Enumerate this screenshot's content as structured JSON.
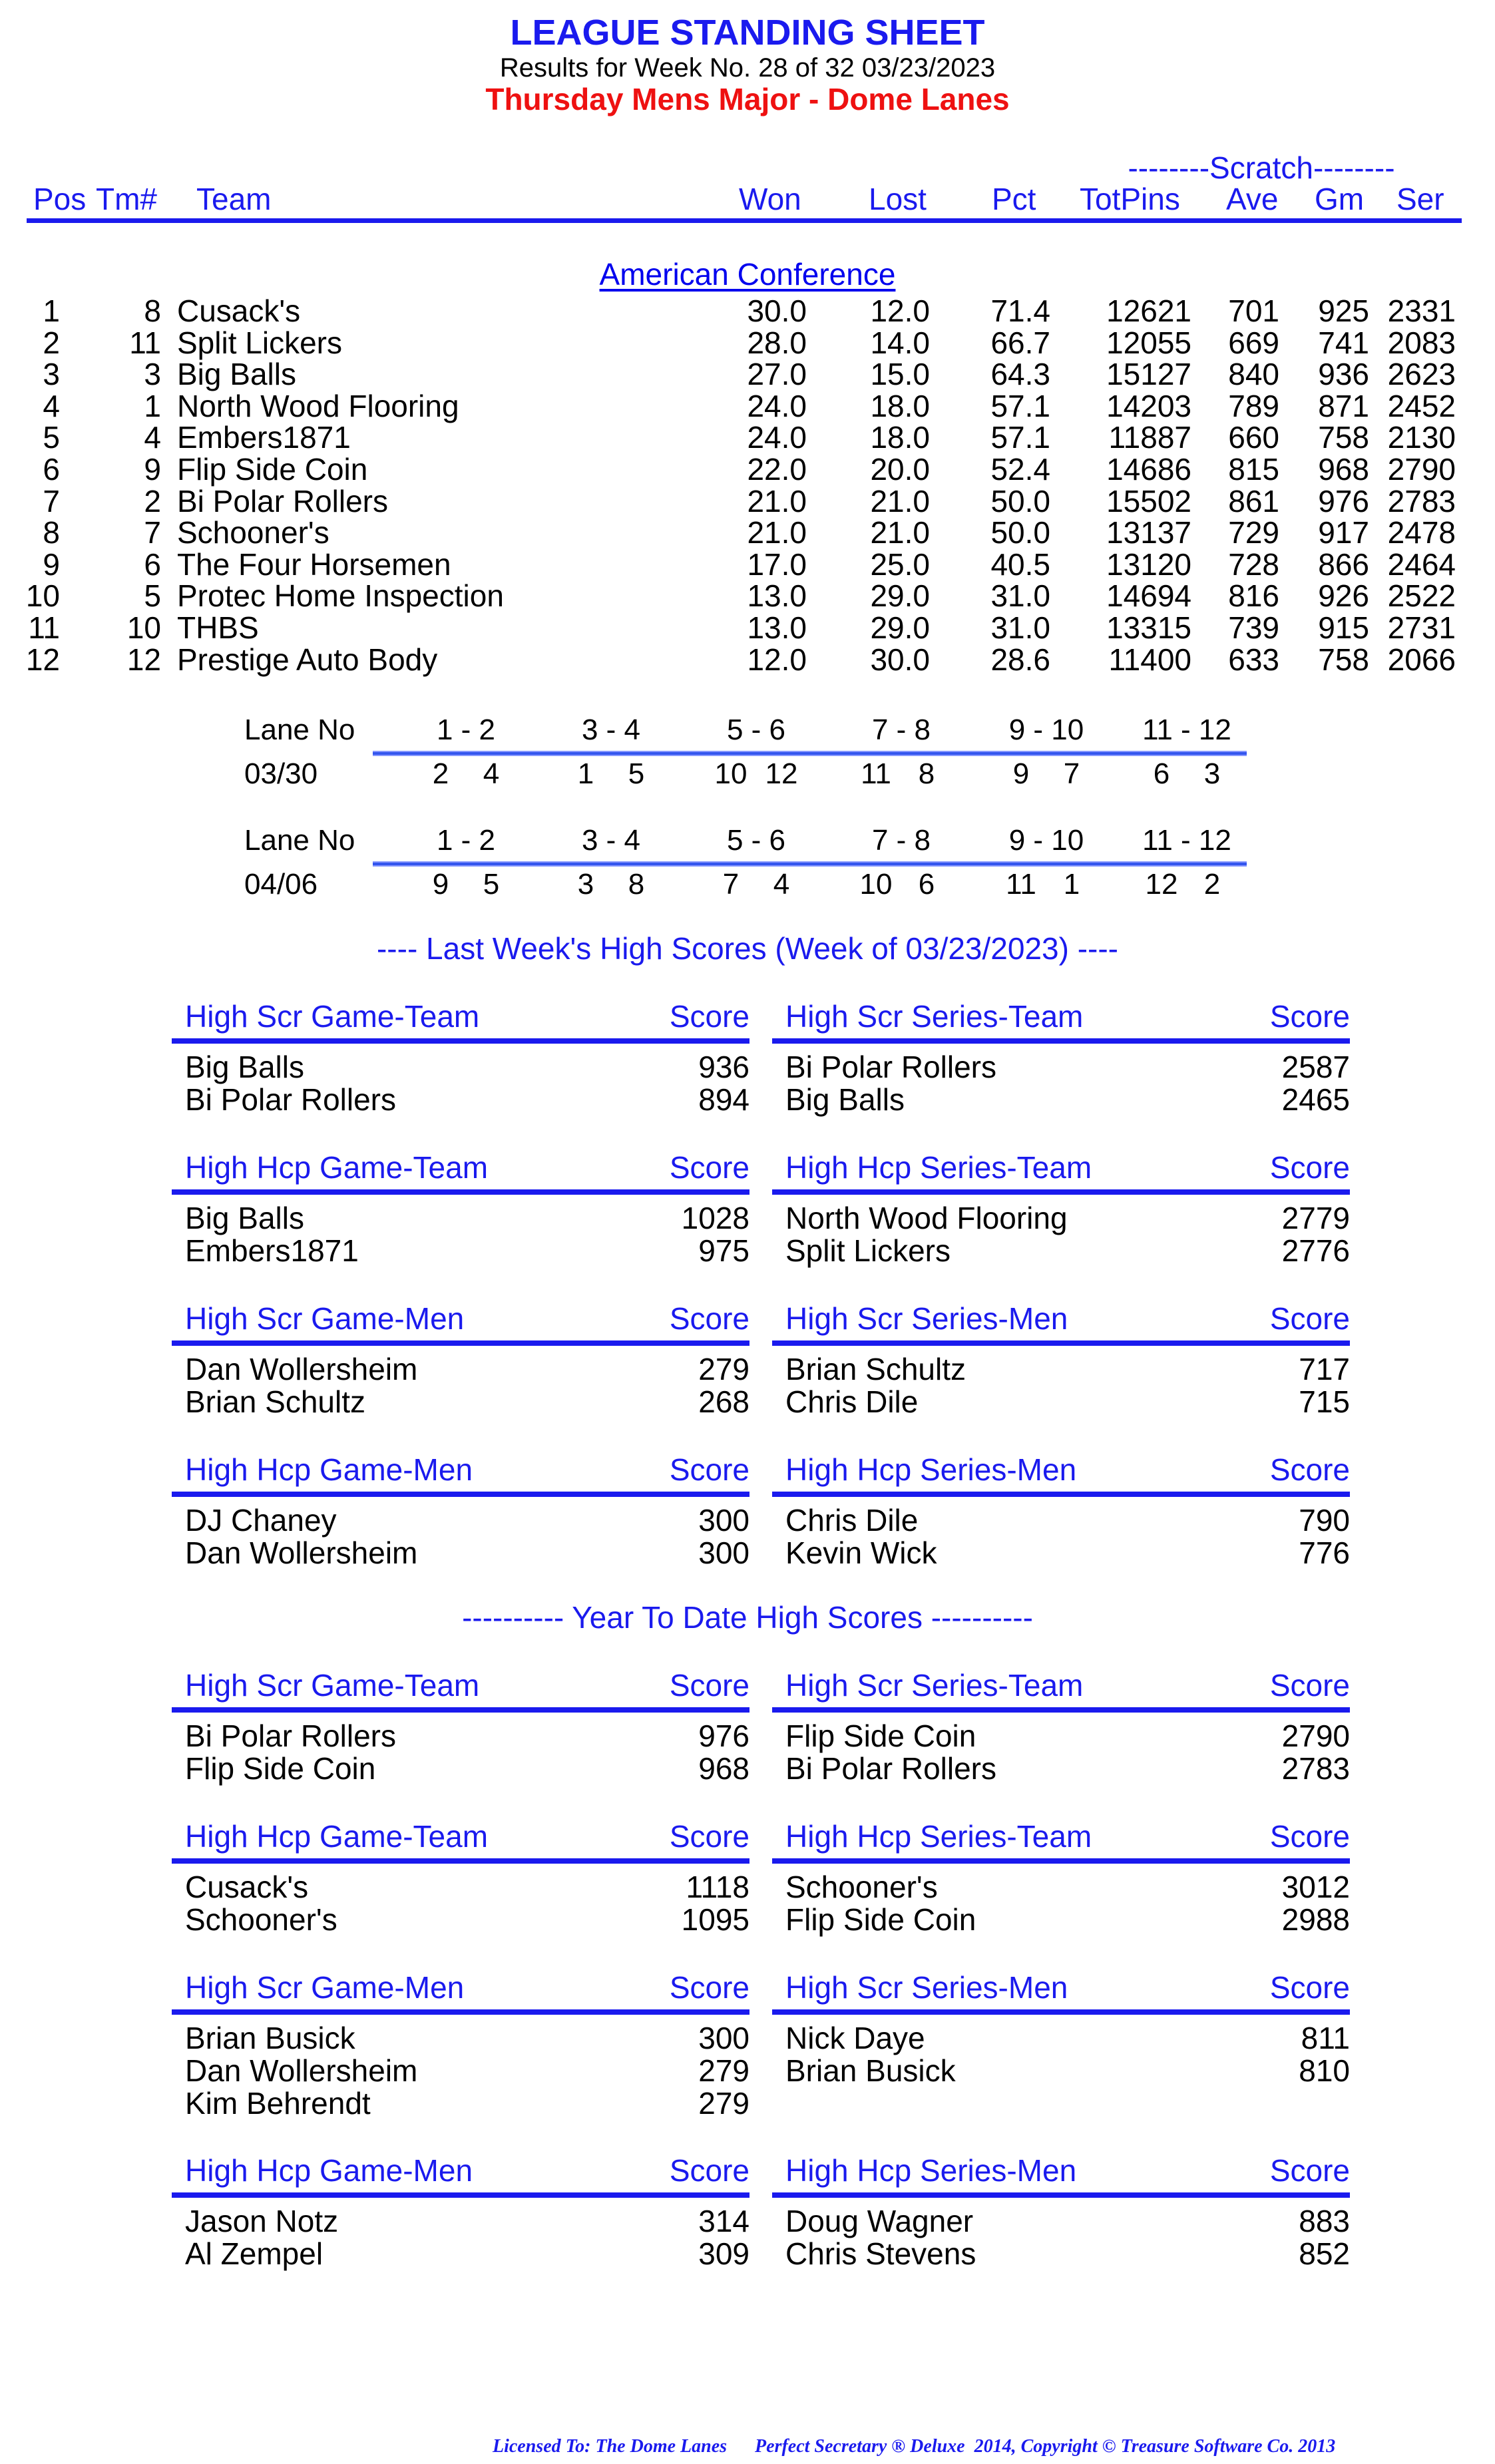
{
  "header": {
    "title": "LEAGUE STANDING SHEET",
    "subtitle": "Results for Week No. 28 of 32    03/23/2023",
    "league_name": "Thursday Mens Major - Dome Lanes"
  },
  "standings": {
    "scratch_label": "--------Scratch--------",
    "columns": {
      "pos": "Pos",
      "tm": "Tm#",
      "team": "Team",
      "won": "Won",
      "lost": "Lost",
      "pct": "Pct",
      "totpins": "TotPins",
      "ave": "Ave",
      "gm": "Gm",
      "ser": "Ser"
    },
    "conference": "American Conference",
    "rows": [
      {
        "pos": "1",
        "tm": "8",
        "team": "Cusack's",
        "won": "30.0",
        "lost": "12.0",
        "pct": "71.4",
        "totpins": "12621",
        "ave": "701",
        "gm": "925",
        "ser": "2331"
      },
      {
        "pos": "2",
        "tm": "11",
        "team": "Split Lickers",
        "won": "28.0",
        "lost": "14.0",
        "pct": "66.7",
        "totpins": "12055",
        "ave": "669",
        "gm": "741",
        "ser": "2083"
      },
      {
        "pos": "3",
        "tm": "3",
        "team": "Big Balls",
        "won": "27.0",
        "lost": "15.0",
        "pct": "64.3",
        "totpins": "15127",
        "ave": "840",
        "gm": "936",
        "ser": "2623"
      },
      {
        "pos": "4",
        "tm": "1",
        "team": "North Wood Flooring",
        "won": "24.0",
        "lost": "18.0",
        "pct": "57.1",
        "totpins": "14203",
        "ave": "789",
        "gm": "871",
        "ser": "2452"
      },
      {
        "pos": "5",
        "tm": "4",
        "team": "Embers1871",
        "won": "24.0",
        "lost": "18.0",
        "pct": "57.1",
        "totpins": "11887",
        "ave": "660",
        "gm": "758",
        "ser": "2130"
      },
      {
        "pos": "6",
        "tm": "9",
        "team": "Flip Side Coin",
        "won": "22.0",
        "lost": "20.0",
        "pct": "52.4",
        "totpins": "14686",
        "ave": "815",
        "gm": "968",
        "ser": "2790"
      },
      {
        "pos": "7",
        "tm": "2",
        "team": "Bi Polar Rollers",
        "won": "21.0",
        "lost": "21.0",
        "pct": "50.0",
        "totpins": "15502",
        "ave": "861",
        "gm": "976",
        "ser": "2783"
      },
      {
        "pos": "8",
        "tm": "7",
        "team": "Schooner's",
        "won": "21.0",
        "lost": "21.0",
        "pct": "50.0",
        "totpins": "13137",
        "ave": "729",
        "gm": "917",
        "ser": "2478"
      },
      {
        "pos": "9",
        "tm": "6",
        "team": "The Four Horsemen",
        "won": "17.0",
        "lost": "25.0",
        "pct": "40.5",
        "totpins": "13120",
        "ave": "728",
        "gm": "866",
        "ser": "2464"
      },
      {
        "pos": "10",
        "tm": "5",
        "team": "Protec Home Inspection",
        "won": "13.0",
        "lost": "29.0",
        "pct": "31.0",
        "totpins": "14694",
        "ave": "816",
        "gm": "926",
        "ser": "2522"
      },
      {
        "pos": "11",
        "tm": "10",
        "team": "THBS",
        "won": "13.0",
        "lost": "29.0",
        "pct": "31.0",
        "totpins": "13315",
        "ave": "739",
        "gm": "915",
        "ser": "2731"
      },
      {
        "pos": "12",
        "tm": "12",
        "team": "Prestige Auto Body",
        "won": "12.0",
        "lost": "30.0",
        "pct": "28.6",
        "totpins": "11400",
        "ave": "633",
        "gm": "758",
        "ser": "2066"
      }
    ]
  },
  "lane_schedule": [
    {
      "label": "Lane No",
      "lanes": [
        "1 - 2",
        "3 - 4",
        "5 - 6",
        "7 - 8",
        "9 - 10",
        "11 - 12"
      ],
      "date": "03/30",
      "pairs": [
        [
          "2",
          "4"
        ],
        [
          "1",
          "5"
        ],
        [
          "10",
          "12"
        ],
        [
          "11",
          "8"
        ],
        [
          "9",
          "7"
        ],
        [
          "6",
          "3"
        ]
      ]
    },
    {
      "label": "Lane No",
      "lanes": [
        "1 - 2",
        "3 - 4",
        "5 - 6",
        "7 - 8",
        "9 - 10",
        "11 - 12"
      ],
      "date": "04/06",
      "pairs": [
        [
          "9",
          "5"
        ],
        [
          "3",
          "8"
        ],
        [
          "7",
          "4"
        ],
        [
          "10",
          "6"
        ],
        [
          "11",
          "1"
        ],
        [
          "12",
          "2"
        ]
      ]
    }
  ],
  "last_week": {
    "title": "----  Last Week's High Scores   (Week of 03/23/2023)  ----",
    "boxes": [
      {
        "title": "High Scr Game-Team",
        "score_label": "Score",
        "items": [
          {
            "name": "Big Balls",
            "score": "936"
          },
          {
            "name": "Bi Polar Rollers",
            "score": "894"
          }
        ]
      },
      {
        "title": "High Scr Series-Team",
        "score_label": "Score",
        "items": [
          {
            "name": "Bi Polar Rollers",
            "score": "2587"
          },
          {
            "name": "Big Balls",
            "score": "2465"
          }
        ]
      },
      {
        "title": "High Hcp Game-Team",
        "score_label": "Score",
        "items": [
          {
            "name": "Big Balls",
            "score": "1028"
          },
          {
            "name": "Embers1871",
            "score": "975"
          }
        ]
      },
      {
        "title": "High Hcp Series-Team",
        "score_label": "Score",
        "items": [
          {
            "name": "North Wood Flooring",
            "score": "2779"
          },
          {
            "name": "Split Lickers",
            "score": "2776"
          }
        ]
      },
      {
        "title": "High Scr Game-Men",
        "score_label": "Score",
        "items": [
          {
            "name": "Dan Wollersheim",
            "score": "279"
          },
          {
            "name": "Brian Schultz",
            "score": "268"
          }
        ]
      },
      {
        "title": "High Scr Series-Men",
        "score_label": "Score",
        "items": [
          {
            "name": "Brian Schultz",
            "score": "717"
          },
          {
            "name": "Chris Dile",
            "score": "715"
          }
        ]
      },
      {
        "title": "High Hcp Game-Men",
        "score_label": "Score",
        "items": [
          {
            "name": "DJ Chaney",
            "score": "300"
          },
          {
            "name": "Dan Wollersheim",
            "score": "300"
          }
        ]
      },
      {
        "title": "High Hcp Series-Men",
        "score_label": "Score",
        "items": [
          {
            "name": "Chris Dile",
            "score": "790"
          },
          {
            "name": "Kevin Wick",
            "score": "776"
          }
        ]
      }
    ]
  },
  "year_to_date": {
    "title": "---------- Year To Date High Scores ----------",
    "boxes": [
      {
        "title": "High Scr Game-Team",
        "score_label": "Score",
        "items": [
          {
            "name": "Bi Polar Rollers",
            "score": "976"
          },
          {
            "name": "Flip Side Coin",
            "score": "968"
          }
        ]
      },
      {
        "title": "High Scr Series-Team",
        "score_label": "Score",
        "items": [
          {
            "name": "Flip Side Coin",
            "score": "2790"
          },
          {
            "name": "Bi Polar Rollers",
            "score": "2783"
          }
        ]
      },
      {
        "title": "High Hcp Game-Team",
        "score_label": "Score",
        "items": [
          {
            "name": "Cusack's",
            "score": "1118"
          },
          {
            "name": "Schooner's",
            "score": "1095"
          }
        ]
      },
      {
        "title": "High Hcp Series-Team",
        "score_label": "Score",
        "items": [
          {
            "name": "Schooner's",
            "score": "3012"
          },
          {
            "name": "Flip Side Coin",
            "score": "2988"
          }
        ]
      },
      {
        "title": "High Scr Game-Men",
        "score_label": "Score",
        "items": [
          {
            "name": "Brian Busick",
            "score": "300"
          },
          {
            "name": "Dan Wollersheim",
            "score": "279"
          },
          {
            "name": "Kim Behrendt",
            "score": "279"
          }
        ]
      },
      {
        "title": "High Scr Series-Men",
        "score_label": "Score",
        "items": [
          {
            "name": "Nick Daye",
            "score": "811"
          },
          {
            "name": "Brian Busick",
            "score": "810"
          }
        ]
      },
      {
        "title": "High Hcp Game-Men",
        "score_label": "Score",
        "items": [
          {
            "name": "Jason Notz",
            "score": "314"
          },
          {
            "name": "Al Zempel",
            "score": "309"
          }
        ]
      },
      {
        "title": "High Hcp Series-Men",
        "score_label": "Score",
        "items": [
          {
            "name": "Doug Wagner",
            "score": "883"
          },
          {
            "name": "Chris Stevens",
            "score": "852"
          }
        ]
      }
    ]
  },
  "footer": {
    "text": "Licensed To: The Dome Lanes      Perfect Secretary ® Deluxe  2014, Copyright © Treasure Software Co. 2013"
  },
  "colors": {
    "heading_blue": "#1a1aee",
    "league_red": "#ee1111",
    "text": "#000000"
  }
}
